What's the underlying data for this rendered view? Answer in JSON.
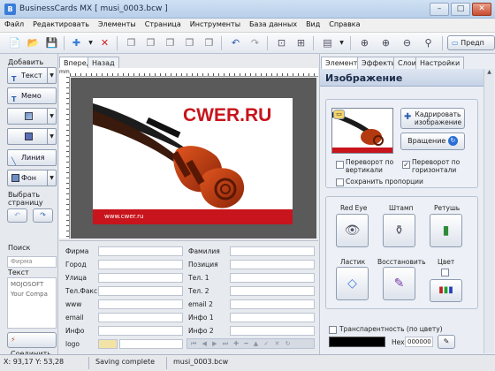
{
  "window": {
    "title": "BusinessCards MX [ musi_0003.bcw ]",
    "minimize": "–",
    "maximize": "□",
    "close": "✕"
  },
  "menu": [
    "Файл",
    "Редактировать",
    "Элементы",
    "Страница",
    "Инструменты",
    "База данных",
    "Вид",
    "Справка"
  ],
  "toolbar": {
    "preview_label": "Предп"
  },
  "left_panel": {
    "add_label": "Добавить",
    "text_button": "Текст",
    "memo_button": "Мемо",
    "line_button": "Линия",
    "background_button": "Фон",
    "select_page_label": "Выбрать страницу"
  },
  "doc_tabs": [
    "Вперед",
    "Назад"
  ],
  "ruler_unit": "mm",
  "card": {
    "logo": "CWER.RU",
    "url": "www.cwer.ru"
  },
  "search_panel": {
    "search_label": "Поиск",
    "search_placeholder": "Фирма",
    "text_label": "Текст",
    "list_items": [
      "MOJOSOFT",
      "Your Compa"
    ],
    "connect_button": "Соединить"
  },
  "fields": {
    "left": [
      "Фирма",
      "Город",
      "Улица",
      "Тел.Факс",
      "www",
      "email",
      "Инфо",
      "logo"
    ],
    "right": [
      "Фамилия",
      "Позиция",
      "Тел. 1",
      "Тел. 2",
      "email 2",
      "Инфо 1",
      "Инфо 2"
    ]
  },
  "right_panel": {
    "tabs": [
      "Элементы",
      "Эффекты",
      "Слои",
      "Настройки"
    ],
    "title": "Изображение",
    "crop_button": "Кадрировать изображение",
    "rotate_button": "Вращение",
    "flip_vertical": "Переворот по вертикали",
    "flip_horizontal": "Переворот по горизонтали",
    "keep_proportions": "Сохранить пропорции",
    "redeye_label": "Red Eye",
    "stamp_label": "Штамп",
    "retouch_label": "Ретушь",
    "eraser_label": "Ластик",
    "restore_label": "Восстановить",
    "color_label": "Цвет",
    "transparency_label": "Транспарентность (по цвету)",
    "hex_label": "Hex",
    "hex_value": "000000"
  },
  "status": {
    "coords": "X: 93,17  Y: 53,28",
    "message": "Saving complete",
    "file": "musi_0003.bcw"
  },
  "colors": {
    "brand_red": "#c8141c",
    "titlebar": "#b9cfe9"
  }
}
